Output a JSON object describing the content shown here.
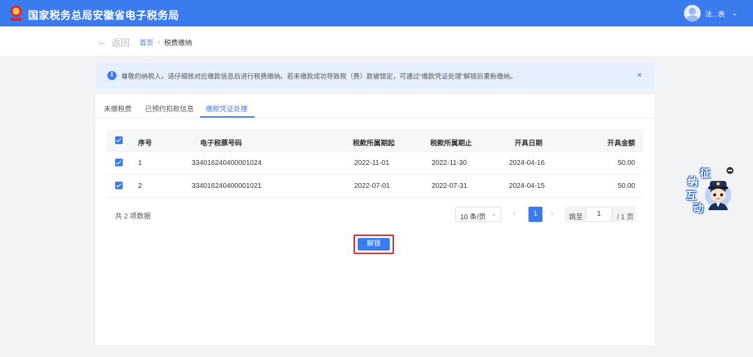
{
  "header": {
    "site_title": "国家税务总局安徽省电子税务局",
    "user_name": "法...表"
  },
  "breadcrumb": {
    "back_label": "返回",
    "home": "首页",
    "separator": "›",
    "current": "税费缴纳"
  },
  "notice": {
    "text": "尊敬的纳税人，请仔细核对应缴款信息后进行税费缴纳。若未缴款成功导致税（费）款被锁定，可通过“缴款凭证处理”解锁后重新缴纳。",
    "close": "×"
  },
  "tabs": [
    {
      "label": "未缴税费"
    },
    {
      "label": "已预约扣款信息"
    },
    {
      "label": "缴款凭证处理"
    }
  ],
  "table": {
    "headers": {
      "seq": "序号",
      "code": "电子税票号码",
      "start": "税款所属期起",
      "end": "税款所属期止",
      "issue_date": "开具日期",
      "amount": "开具金额"
    },
    "rows": [
      {
        "seq": "1",
        "code": "334016240400001024",
        "start": "2022-11-01",
        "end": "2022-11-30",
        "issue_date": "2024-04-16",
        "amount": "50.00"
      },
      {
        "seq": "2",
        "code": "334016240400001021",
        "start": "2022-07-01",
        "end": "2022-07-31",
        "issue_date": "2024-04-15",
        "amount": "50.00"
      }
    ]
  },
  "pagination": {
    "total_text": "共 2 项数据",
    "page_size": "10 条/页",
    "prev": "‹",
    "current_page": "1",
    "next": "›",
    "jump_label": "跳至",
    "jump_value": "1",
    "total_pages": "/ 1 页"
  },
  "actions": {
    "unlock": "解锁"
  },
  "widget": {
    "chars": [
      "征",
      "纳",
      "互",
      "动"
    ]
  },
  "colors": {
    "primary": "#3a7bf0",
    "highlight_border": "#e0262c"
  }
}
